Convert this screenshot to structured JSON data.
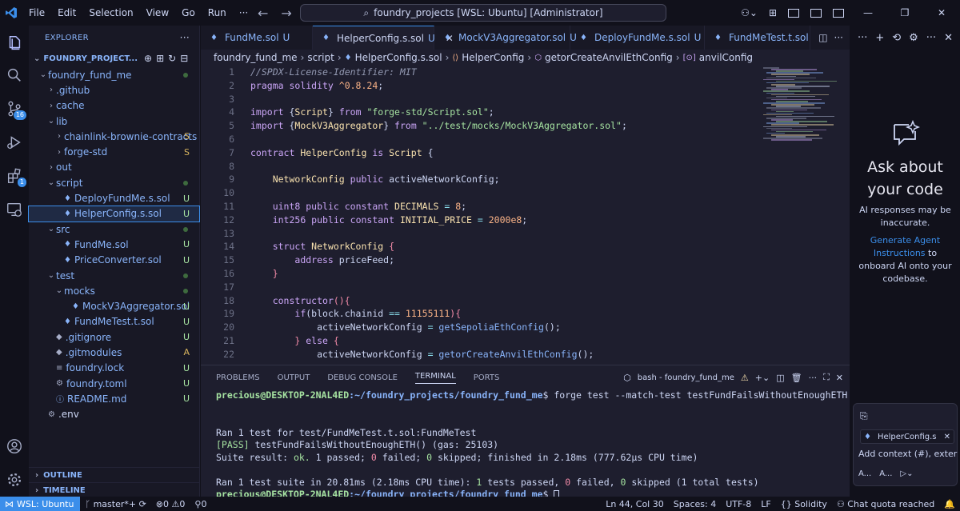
{
  "titlebar": {
    "menu": [
      "File",
      "Edit",
      "Selection",
      "View",
      "Go",
      "Run",
      "···"
    ],
    "search_text": "foundry_projects [WSL: Ubuntu] [Administrator]"
  },
  "activity": {
    "scm_badge": "16",
    "ext_badge": "1"
  },
  "explorer": {
    "header": "EXPLORER",
    "more": "···",
    "project": "FOUNDRY_PROJECT...",
    "items": [
      {
        "label": "foundry_fund_me",
        "indent": 1,
        "kind": "folder-open",
        "status": "dot"
      },
      {
        "label": ".github",
        "indent": 2,
        "kind": "folder",
        "status": ""
      },
      {
        "label": "cache",
        "indent": 2,
        "kind": "folder",
        "status": ""
      },
      {
        "label": "lib",
        "indent": 2,
        "kind": "folder-open",
        "status": ""
      },
      {
        "label": "chainlink-brownie-contracts",
        "indent": 3,
        "kind": "folder",
        "status": "S"
      },
      {
        "label": "forge-std",
        "indent": 3,
        "kind": "folder",
        "status": "S"
      },
      {
        "label": "out",
        "indent": 2,
        "kind": "folder",
        "status": ""
      },
      {
        "label": "script",
        "indent": 2,
        "kind": "folder-open",
        "status": "dot"
      },
      {
        "label": "DeployFundMe.s.sol",
        "indent": 3,
        "kind": "sol",
        "status": "U"
      },
      {
        "label": "HelperConfig.s.sol",
        "indent": 3,
        "kind": "sol",
        "status": "U",
        "selected": true
      },
      {
        "label": "src",
        "indent": 2,
        "kind": "folder-open",
        "status": "dot"
      },
      {
        "label": "FundMe.sol",
        "indent": 3,
        "kind": "sol",
        "status": "U"
      },
      {
        "label": "PriceConverter.sol",
        "indent": 3,
        "kind": "sol",
        "status": "U"
      },
      {
        "label": "test",
        "indent": 2,
        "kind": "folder-open",
        "status": "dot"
      },
      {
        "label": "mocks",
        "indent": 3,
        "kind": "folder-open",
        "status": "dot"
      },
      {
        "label": "MockV3Aggregator.sol",
        "indent": 4,
        "kind": "sol",
        "status": "U"
      },
      {
        "label": "FundMeTest.t.sol",
        "indent": 3,
        "kind": "sol",
        "status": "U"
      },
      {
        "label": ".gitignore",
        "indent": 2,
        "kind": "git",
        "status": "U"
      },
      {
        "label": ".gitmodules",
        "indent": 2,
        "kind": "git",
        "status": "A"
      },
      {
        "label": "foundry.lock",
        "indent": 2,
        "kind": "file",
        "status": "U"
      },
      {
        "label": "foundry.toml",
        "indent": 2,
        "kind": "gear",
        "status": "U"
      },
      {
        "label": "README.md",
        "indent": 2,
        "kind": "info",
        "status": "U"
      },
      {
        "label": ".env",
        "indent": 1,
        "kind": "gear",
        "status": ""
      }
    ],
    "outline": "OUTLINE",
    "timeline": "TIMELINE"
  },
  "tabs": [
    {
      "label": "FundMe.sol",
      "status": "U",
      "active": false
    },
    {
      "label": "HelperConfig.s.sol",
      "status": "U",
      "active": true
    },
    {
      "label": "MockV3Aggregator.sol",
      "status": "U",
      "active": false
    },
    {
      "label": "DeployFundMe.s.sol",
      "status": "U",
      "active": false
    },
    {
      "label": "FundMeTest.t.sol",
      "status": "",
      "active": false
    }
  ],
  "breadcrumb": [
    "foundry_fund_me",
    "script",
    "HelperConfig.s.sol",
    "HelperConfig",
    "getorCreateAnvilEthConfig",
    "anvilConfig"
  ],
  "editor": {
    "line_numbers": [
      "1",
      "2",
      "3",
      "4",
      "5",
      "6",
      "7",
      "8",
      "9",
      "10",
      "11",
      "12",
      "13",
      "14",
      "15",
      "16",
      "17",
      "18",
      "19",
      "20",
      "21",
      "22"
    ],
    "code": [
      [
        [
          "cm",
          "//SPDX-License-Identifier: MIT"
        ]
      ],
      [
        [
          "kw",
          "pragma"
        ],
        [
          "",
          ""
        ],
        [
          "kw",
          " solidity"
        ],
        [
          "nm",
          " ^0.8.24"
        ],
        [
          "",
          ";"
        ]
      ],
      [],
      [
        [
          "kw",
          "import"
        ],
        [
          "",
          " {"
        ],
        [
          "ty",
          "Script"
        ],
        [
          "",
          "} "
        ],
        [
          "kw",
          "from"
        ],
        [
          "st",
          " \"forge-std/Script.sol\""
        ],
        [
          "",
          ";"
        ]
      ],
      [
        [
          "kw",
          "import"
        ],
        [
          "",
          " {"
        ],
        [
          "ty",
          "MockV3Aggregator"
        ],
        [
          "",
          "} "
        ],
        [
          "kw",
          "from"
        ],
        [
          "st",
          " \"../test/mocks/MockV3Aggregator.sol\""
        ],
        [
          "",
          ";"
        ]
      ],
      [],
      [
        [
          "kw",
          "contract"
        ],
        [
          "ty",
          " HelperConfig"
        ],
        [
          "kw",
          " is"
        ],
        [
          "ty",
          " Script"
        ],
        [
          "",
          " {"
        ]
      ],
      [],
      [
        [
          "",
          "    "
        ],
        [
          "ty",
          "NetworkConfig"
        ],
        [
          "kw",
          " public"
        ],
        [
          "",
          " activeNetworkConfig;"
        ]
      ],
      [],
      [
        [
          "",
          "    "
        ],
        [
          "kw",
          "uint8"
        ],
        [
          "kw",
          " public"
        ],
        [
          "kw",
          " constant"
        ],
        [
          "ty",
          " DECIMALS"
        ],
        [
          "op",
          " ="
        ],
        [
          "nm",
          " 8"
        ],
        [
          "",
          ";"
        ]
      ],
      [
        [
          "",
          "    "
        ],
        [
          "kw",
          "int256"
        ],
        [
          "kw",
          " public"
        ],
        [
          "kw",
          " constant"
        ],
        [
          "ty",
          " INITIAL_PRICE"
        ],
        [
          "op",
          " ="
        ],
        [
          "nm",
          " 2000e8"
        ],
        [
          "",
          ";"
        ]
      ],
      [],
      [
        [
          "",
          "    "
        ],
        [
          "kw",
          "struct"
        ],
        [
          "ty",
          " NetworkConfig"
        ],
        [
          "br",
          " {"
        ]
      ],
      [
        [
          "",
          "        "
        ],
        [
          "kw",
          "address"
        ],
        [
          "",
          " priceFeed;"
        ]
      ],
      [
        [
          "",
          "    "
        ],
        [
          "br",
          "}"
        ]
      ],
      [],
      [
        [
          "",
          "    "
        ],
        [
          "kw",
          "constructor"
        ],
        [
          "",
          ""
        ],
        [
          "br",
          "(){"
        ]
      ],
      [
        [
          "",
          "        "
        ],
        [
          "kw",
          "if"
        ],
        [
          "",
          "(block.chainid "
        ],
        [
          "op",
          "=="
        ],
        [
          "nm",
          " 11155111"
        ],
        [
          "",
          ""
        ],
        [
          "br",
          "){"
        ]
      ],
      [
        [
          "",
          "            activeNetworkConfig "
        ],
        [
          "op",
          "="
        ],
        [
          "fn",
          " getSepoliaEthConfig"
        ],
        [
          "",
          "();"
        ]
      ],
      [
        [
          "",
          "        "
        ],
        [
          "br",
          "}"
        ],
        [
          "kw",
          " else"
        ],
        [
          "br",
          " {"
        ]
      ],
      [
        [
          "",
          "            activeNetworkConfig "
        ],
        [
          "op",
          "="
        ],
        [
          "fn",
          " getorCreateAnvilEthConfig"
        ],
        [
          "",
          "();"
        ]
      ]
    ]
  },
  "panel": {
    "tabs": [
      "PROBLEMS",
      "OUTPUT",
      "DEBUG CONSOLE",
      "TERMINAL",
      "PORTS"
    ],
    "active_tab": "TERMINAL",
    "terminal_name": "bash - foundry_fund_me",
    "prompt_user": "precious@DESKTOP-2NAL4ED",
    "prompt_path": ":~/foundry_projects/foundry_fund_me",
    "command": "$ forge test --match-test testFundFailsWithoutEnoughETH",
    "ran_line": "Ran 1 test for test/FundMeTest.t.sol:FundMeTest",
    "pass_tag": "[PASS]",
    "pass_rest": " testFundFailsWithoutEnoughETH() (gas: 25103)",
    "suite_line_a": "Suite result: ",
    "suite_ok": "ok.",
    "suite_line_b": " 1 passed; ",
    "suite_fail": "0",
    "suite_line_c": " failed; ",
    "suite_skip": "0",
    "suite_line_d": " skipped; finished in 2.18ms (777.62µs CPU time)",
    "summary_a": "Ran 1 test suite in 20.81ms (2.18ms CPU time): ",
    "summary_pass": "1",
    "summary_b": " tests passed, ",
    "summary_fail": "0",
    "summary_c": " failed, ",
    "summary_skip": "0",
    "summary_d": " skipped (1 total tests)",
    "prompt_end": "$ "
  },
  "chat": {
    "title": "Ask about your code",
    "disclaimer": "AI responses may be inaccurate.",
    "link": "Generate Agent Instructions",
    "desc_rest": " to onboard AI onto your codebase.",
    "chip": "HelperConfig.s",
    "context": "Add context (#), exter",
    "mode_a": "A...",
    "mode_b": "A..."
  },
  "statusbar": {
    "remote": "WSL: Ubuntu",
    "branch": "master*+",
    "errors": "0",
    "warnings": "0",
    "ports": "0",
    "position": "Ln 44, Col 30",
    "spaces": "Spaces: 4",
    "encoding": "UTF-8",
    "eol": "LF",
    "language": "Solidity",
    "quota": "Chat quota reached"
  },
  "colors": {
    "accent": "#3b8eea",
    "git_untracked": "#a6e3a1",
    "git_submodule": "#d8b45e"
  }
}
